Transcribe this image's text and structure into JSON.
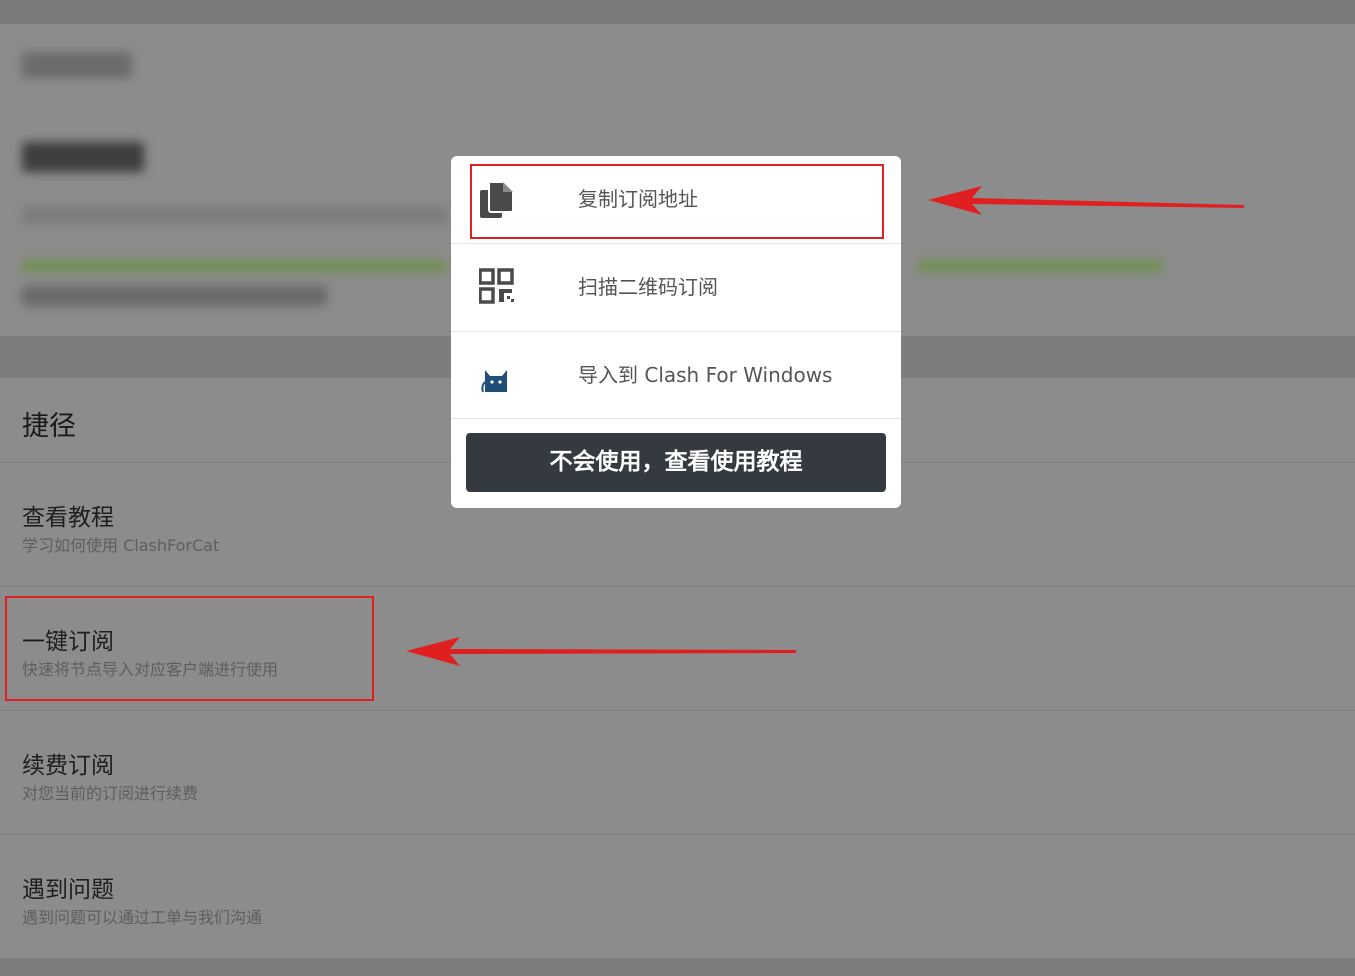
{
  "shortcuts": {
    "title": "捷径",
    "items": [
      {
        "title": "查看教程",
        "desc": "学习如何使用 ClashForCat"
      },
      {
        "title": "一键订阅",
        "desc": "快速将节点导入对应客户端进行使用"
      },
      {
        "title": "续费订阅",
        "desc": "对您当前的订阅进行续费"
      },
      {
        "title": "遇到问题",
        "desc": "遇到问题可以通过工单与我们沟通"
      }
    ]
  },
  "modal": {
    "items": [
      {
        "label": "复制订阅地址",
        "icon": "copy-icon"
      },
      {
        "label": "扫描二维码订阅",
        "icon": "qrcode-icon"
      },
      {
        "label": "导入到 Clash For Windows",
        "icon": "clash-cat-icon"
      }
    ],
    "tutorial_button": "不会使用，查看使用教程"
  },
  "colors": {
    "overlay_bg": "#7f7f7f",
    "annotation_red": "#e02020",
    "button_dark": "#343a40",
    "progress_green": "#6f8f4f"
  }
}
